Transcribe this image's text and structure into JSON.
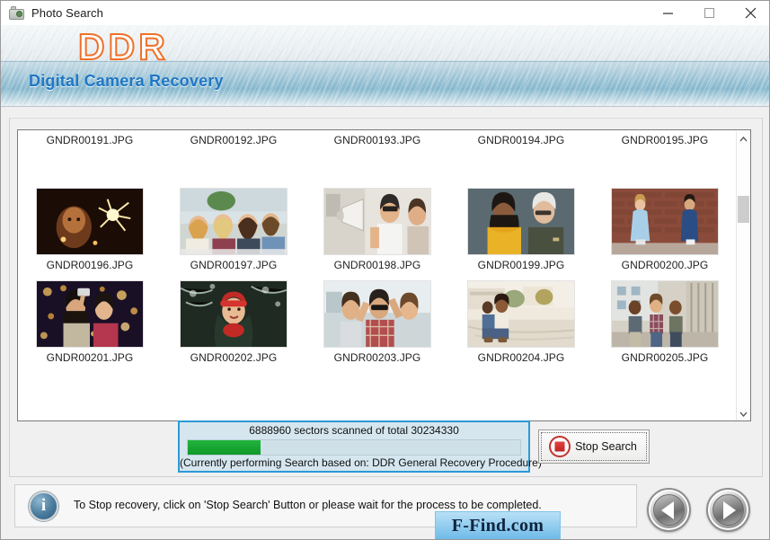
{
  "window": {
    "title": "Photo Search",
    "icon": "camera-icon",
    "controls": {
      "minimize": "minimize-icon",
      "maximize": "maximize-icon",
      "close": "close-icon"
    }
  },
  "banner": {
    "logo": "DDR",
    "subtitle": "Digital Camera Recovery",
    "logo_color": "#f07028",
    "subtitle_color": "#1f77c4"
  },
  "file_list": {
    "scrollbar": {
      "up_icon": "chevron-up-icon",
      "down_icon": "chevron-down-icon"
    },
    "rows": [
      {
        "labels_top": [
          "GNDR00191.JPG",
          "GNDR00192.JPG",
          "GNDR00193.JPG",
          "GNDR00194.JPG",
          "GNDR00195.JPG"
        ],
        "items": [
          {
            "name": "GNDR00196.JPG",
            "thumb": "girl-with-sparkler-night"
          },
          {
            "name": "GNDR00197.JPG",
            "thumb": "four-friends-selfie-street"
          },
          {
            "name": "GNDR00198.JPG",
            "thumb": "woman-with-megaphone"
          },
          {
            "name": "GNDR00199.JPG",
            "thumb": "two-women-talking-yellow-sweater"
          },
          {
            "name": "GNDR00200.JPG",
            "thumb": "couple-against-brick-wall"
          }
        ]
      },
      {
        "items": [
          {
            "name": "GNDR00201.JPG",
            "thumb": "two-women-selfie-bokeh-lights"
          },
          {
            "name": "GNDR00202.JPG",
            "thumb": "woman-red-beanie-snow"
          },
          {
            "name": "GNDR00203.JPG",
            "thumb": "friends-cheering-plaid-shirt"
          },
          {
            "name": "GNDR00204.JPG",
            "thumb": "couple-sitting-city-steps"
          },
          {
            "name": "GNDR00205.JPG",
            "thumb": "three-men-walking-street"
          }
        ]
      }
    ]
  },
  "progress": {
    "label": "6888960  sectors scanned of total 30234330",
    "sub_label": "(Currently performing Search based on:  DDR General Recovery Procedure)",
    "percent": 22,
    "fill_color": "#10992c",
    "border_color": "#2a9ad6",
    "scanned_sectors": 6888960,
    "total_sectors": 30234330
  },
  "stop_button": {
    "label": "Stop Search",
    "icon": "stop-icon"
  },
  "info_bar": {
    "icon": "info-icon",
    "message": "To Stop recovery, click on 'Stop Search' Button or please wait for the process to be completed."
  },
  "watermark": {
    "text": "F-Find.com"
  },
  "navigation": {
    "previous": "previous-arrow-icon",
    "next": "next-arrow-icon"
  }
}
